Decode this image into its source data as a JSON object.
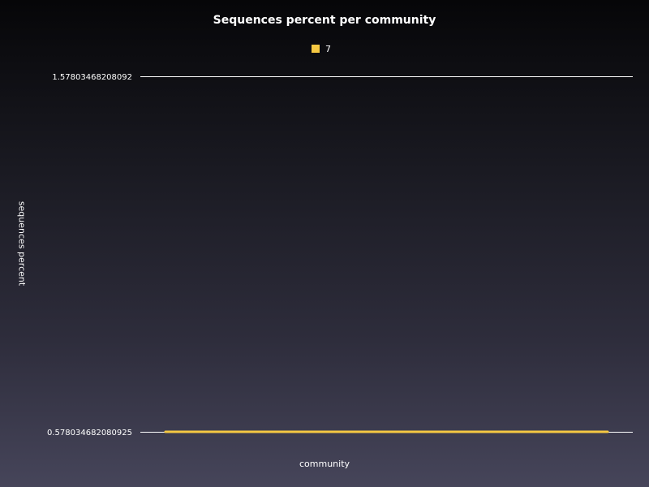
{
  "chart_data": {
    "type": "line",
    "title": "Sequences percent per community",
    "xlabel": "community",
    "ylabel": "sequences percent",
    "y_ticks": [
      "1.57803468208092",
      "0.578034682080925"
    ],
    "ylim": [
      0.578034682080925,
      1.57803468208092
    ],
    "grid": true,
    "legend_position": "top-center",
    "series": [
      {
        "name": "7",
        "color": "#f5c842",
        "values": [
          0.578034682080925,
          0.578034682080925
        ]
      }
    ]
  }
}
